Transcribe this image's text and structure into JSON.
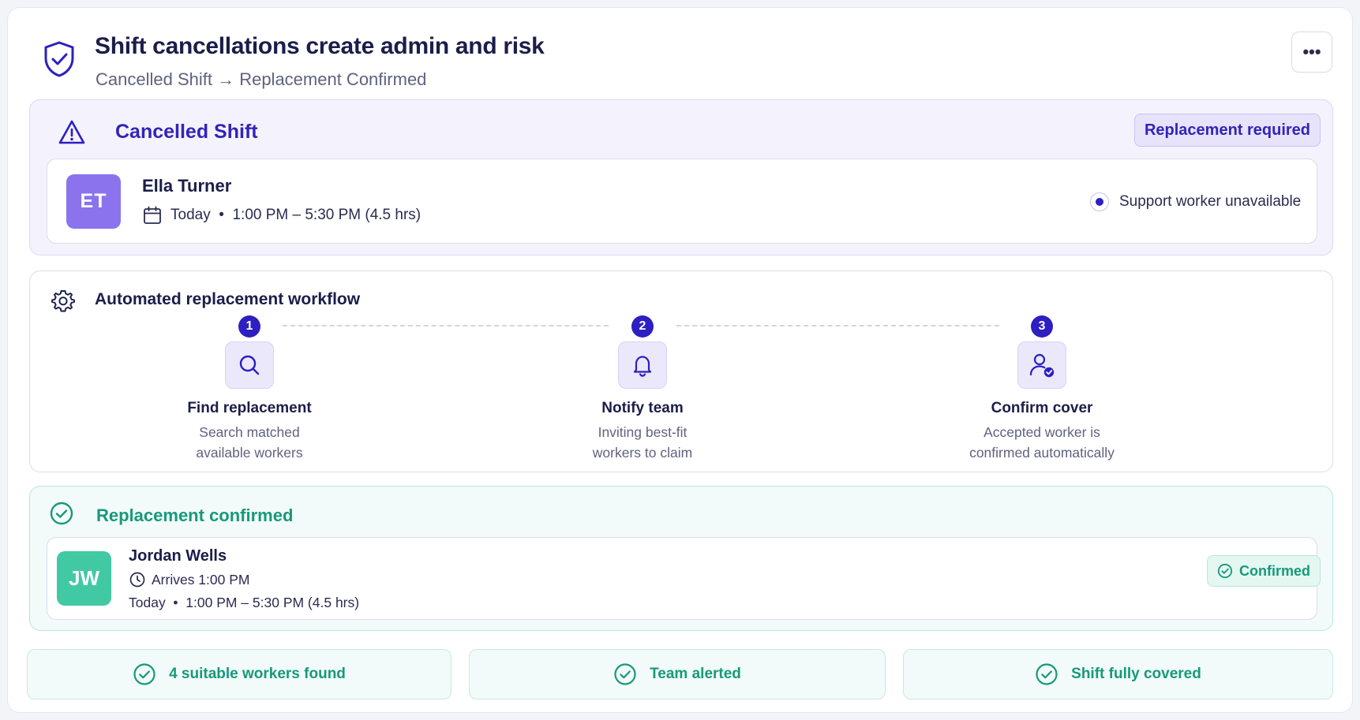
{
  "header": {
    "title": "Shift cancellations create admin and risk",
    "subtitle": "Cancelled Shift → Replacement Confirmed",
    "more_label": "•••"
  },
  "cancelled": {
    "title": "Cancelled Shift",
    "badge": "Replacement required",
    "worker": {
      "initials": "ET",
      "name": "Ella Turner",
      "shift": "Today  •  1:00 PM – 5:30 PM (4.5 hrs)"
    },
    "reason": "Support worker unavailable"
  },
  "workflow": {
    "title": "Automated replacement workflow",
    "steps": [
      {
        "num": "1",
        "icon": "search-icon",
        "title": "Find replacement",
        "desc1": "Search matched",
        "desc2": "available workers"
      },
      {
        "num": "2",
        "icon": "bell-icon",
        "title": "Notify team",
        "desc1": "Inviting best-fit",
        "desc2": "workers to claim"
      },
      {
        "num": "3",
        "icon": "user-check-icon",
        "title": "Confirm cover",
        "desc1": "Accepted worker is",
        "desc2": "confirmed automatically"
      }
    ]
  },
  "replacement": {
    "title": "Replacement confirmed",
    "worker": {
      "initials": "JW",
      "name": "Jordan Wells",
      "arrives": "Arrives 1:00 PM",
      "shift": "Today  •  1:00 PM – 5:30 PM (4.5 hrs)"
    },
    "badge": "Confirmed"
  },
  "summary": [
    {
      "label": "4 suitable workers found"
    },
    {
      "label": "Team alerted"
    },
    {
      "label": "Shift fully covered"
    }
  ],
  "colors": {
    "accent_purple": "#2d1fc1",
    "accent_green": "#17997b",
    "avatar_et": "#8b73ee",
    "avatar_jw": "#41c9a4"
  }
}
